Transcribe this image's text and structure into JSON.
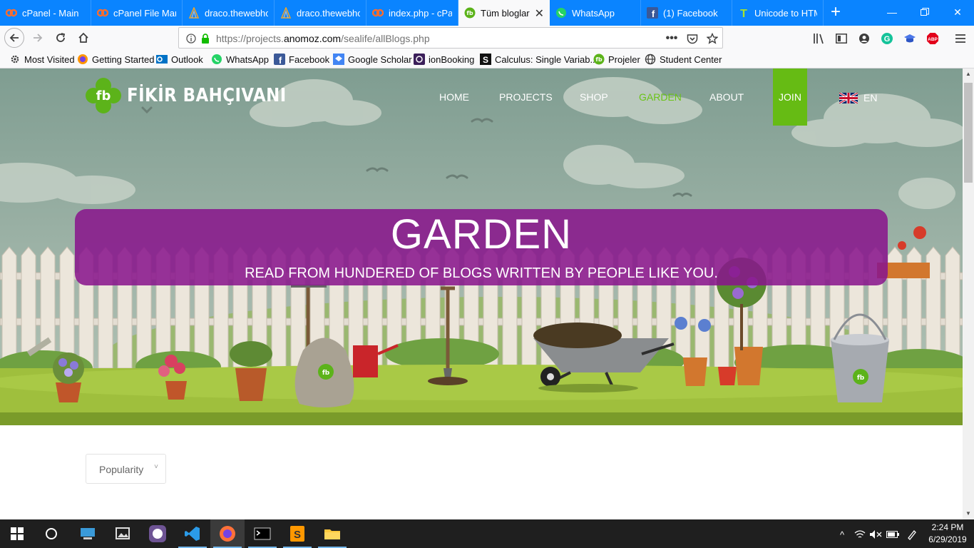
{
  "browser": {
    "tabs": [
      {
        "label": "cPanel - Main",
        "icon": "cpanel-icon"
      },
      {
        "label": "cPanel File Mana",
        "icon": "cpanel-icon"
      },
      {
        "label": "draco.thewebho",
        "icon": "draco-icon"
      },
      {
        "label": "draco.thewebho",
        "icon": "draco-icon"
      },
      {
        "label": "index.php - cPa",
        "icon": "cpanel-icon"
      },
      {
        "label": "Tüm bloglar",
        "icon": "fb-icon"
      },
      {
        "label": "WhatsApp",
        "icon": "whatsapp-icon"
      },
      {
        "label": "(1) Facebook",
        "icon": "facebook-icon"
      },
      {
        "label": "Unicode to HTM",
        "icon": "unicode-icon"
      }
    ],
    "active_tab": 5,
    "url_prefix": "https://projects.",
    "url_domain": "anomoz.com",
    "url_path": "/sealife/allBlogs.php",
    "bookmarks": [
      {
        "label": "Most Visited",
        "icon": "gear-icon"
      },
      {
        "label": "Getting Started",
        "icon": "firefox-icon"
      },
      {
        "label": "Outlook",
        "icon": "outlook-icon"
      },
      {
        "label": "WhatsApp",
        "icon": "whatsapp-icon"
      },
      {
        "label": "Facebook",
        "icon": "facebook-icon"
      },
      {
        "label": "Google Scholar",
        "icon": "scholar-icon"
      },
      {
        "label": "ionBooking",
        "icon": "ion-icon"
      },
      {
        "label": "Calculus: Single Variab...",
        "icon": "coursera-icon"
      },
      {
        "label": "Projeler",
        "icon": "fb-icon"
      },
      {
        "label": "Student Center",
        "icon": "globe-icon"
      }
    ]
  },
  "site": {
    "logo_badge": "fb",
    "logo_text": "FİKİR BAHÇIVANI",
    "nav": {
      "home": "HOME",
      "projects": "PROJECTS",
      "shop": "SHOP",
      "garden": "GARDEN",
      "about": "ABOUT",
      "join": "JOIN",
      "lang": "EN"
    },
    "hero_title": "GARDEN",
    "hero_subtitle": "READ FROM HUNDERED OF BLOGS WRITTEN BY PEOPLE LIKE YOU.",
    "sort_value": "Popularity",
    "sort_caret": "˅",
    "sack_badge": "fb",
    "bucket_badge": "fb"
  },
  "colors": {
    "tabbar": "#0a84ff",
    "accent_green": "#66bb14",
    "banner_purple": "#89168c"
  },
  "taskbar": {
    "time": "2:24 PM",
    "date": "6/29/2019"
  }
}
